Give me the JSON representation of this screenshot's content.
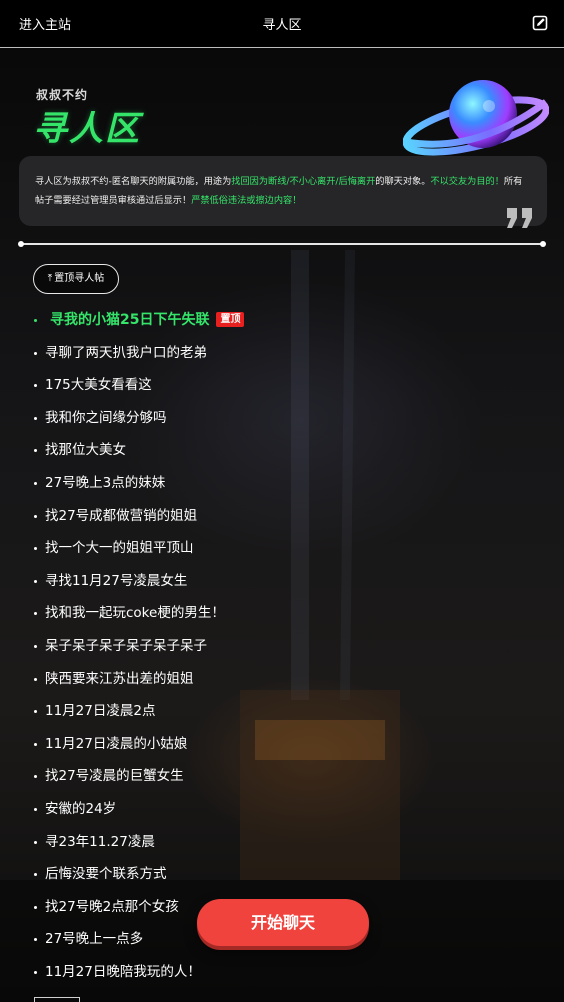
{
  "topbar": {
    "enter_main": "进入主站",
    "title": "寻人区"
  },
  "brand": {
    "small": "叔叔不约",
    "big": "寻人区"
  },
  "intro": {
    "p1": "寻人区为叔叔不约-匿名聊天的附属功能，用途为",
    "p1_green": "找回因为断线/不小心离开/后悔离开",
    "p2": "的聊天对象。",
    "p2_green": "不以交友为目的！",
    "p3": "所有帖子需要经过管理员审核通过后显示！",
    "p3_green": "严禁低俗违法或擦边内容！"
  },
  "pin_button": {
    "label": "置顶寻人帖"
  },
  "posts": {
    "pinned_title": "寻我的小猫25日下午失联",
    "pinned_badge": "置顶",
    "items": [
      "寻聊了两天扒我户口的老弟",
      "175大美女看看这",
      "我和你之间缘分够吗",
      "找那位大美女",
      "27号晚上3点的妹妹",
      "找27号成都做营销的姐姐",
      "找一个大一的姐姐平顶山",
      "寻找11月27号凌晨女生",
      "找和我一起玩coke梗的男生！",
      "呆子呆子呆子呆子呆子呆子",
      "陕西要来江苏出差的姐姐",
      "11月27日凌晨2点",
      "11月27日凌晨的小姑娘",
      "找27号凌晨的巨蟹女生",
      "安徽的24岁",
      "寻23年11.27凌晨",
      "后悔没要个联系方式",
      "找27号晚2点那个女孩",
      "27号晚上一点多",
      "11月27日晚陪我玩的人！"
    ]
  },
  "start_button": {
    "label": "开始聊天"
  },
  "colors": {
    "accent_green": "#35e56a",
    "badge_red": "#e8201f",
    "start_red": "#f0433e"
  },
  "icons": [
    "edit-icon",
    "planet-icon",
    "quote-icon",
    "pin-arrow-icon"
  ]
}
